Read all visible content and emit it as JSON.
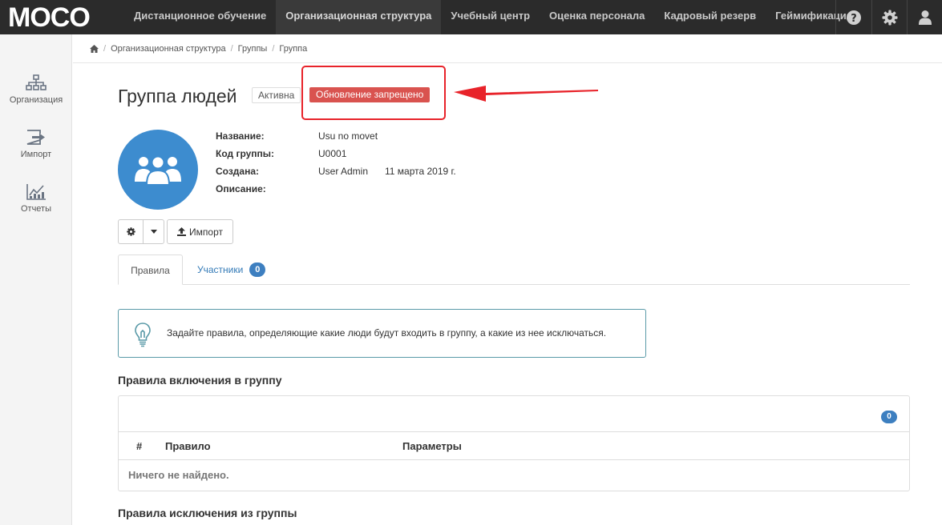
{
  "app": {
    "logo_text": "MOCO"
  },
  "nav": {
    "items": [
      {
        "label": "Дистанционное обучение",
        "active": false
      },
      {
        "label": "Организационная структура",
        "active": true
      },
      {
        "label": "Учебный центр",
        "active": false
      },
      {
        "label": "Оценка персонала",
        "active": false
      },
      {
        "label": "Кадровый резерв",
        "active": false
      },
      {
        "label": "Геймификация",
        "active": false
      }
    ],
    "icons": [
      "help-icon",
      "gear-icon",
      "user-icon"
    ]
  },
  "sidebar": {
    "items": [
      {
        "label": "Организация",
        "icon": "org-chart-icon"
      },
      {
        "label": "Импорт",
        "icon": "import-icon"
      },
      {
        "label": "Отчеты",
        "icon": "reports-icon"
      }
    ]
  },
  "breadcrumb": {
    "home_icon": "home-icon",
    "items": [
      "Организационная структура",
      "Группы",
      "Группа"
    ]
  },
  "header": {
    "title": "Группа людей",
    "status_badge": "Активна",
    "update_badge": "Обновление запрещено"
  },
  "group": {
    "avatar_icon": "group-icon",
    "props": [
      {
        "key": "Название:",
        "value": "Usu no movet"
      },
      {
        "key": "Код группы:",
        "value": "U0001"
      },
      {
        "key": "Создана:",
        "value": "User Admin",
        "date": "11 марта 2019 г."
      },
      {
        "key": "Описание:",
        "value": ""
      }
    ]
  },
  "toolbar": {
    "import_label": "Импорт"
  },
  "tabs": [
    {
      "label": "Правила",
      "active": true
    },
    {
      "label": "Участники",
      "count": "0"
    }
  ],
  "info": {
    "icon": "lightbulb-icon",
    "text": "Задайте правила, определяющие какие люди будут входить в группу, а какие из нее исключаться."
  },
  "inclusion": {
    "title": "Правила включения в группу",
    "count": "0",
    "columns": [
      "#",
      "Правило",
      "Параметры"
    ],
    "empty_text": "Ничего не найдено."
  },
  "exclusion": {
    "title": "Правила исключения из группы"
  },
  "colors": {
    "navbar": "#2b2b2b",
    "accent": "#3d8ccf",
    "danger": "#d9534f",
    "annotation": "#e8232a"
  }
}
